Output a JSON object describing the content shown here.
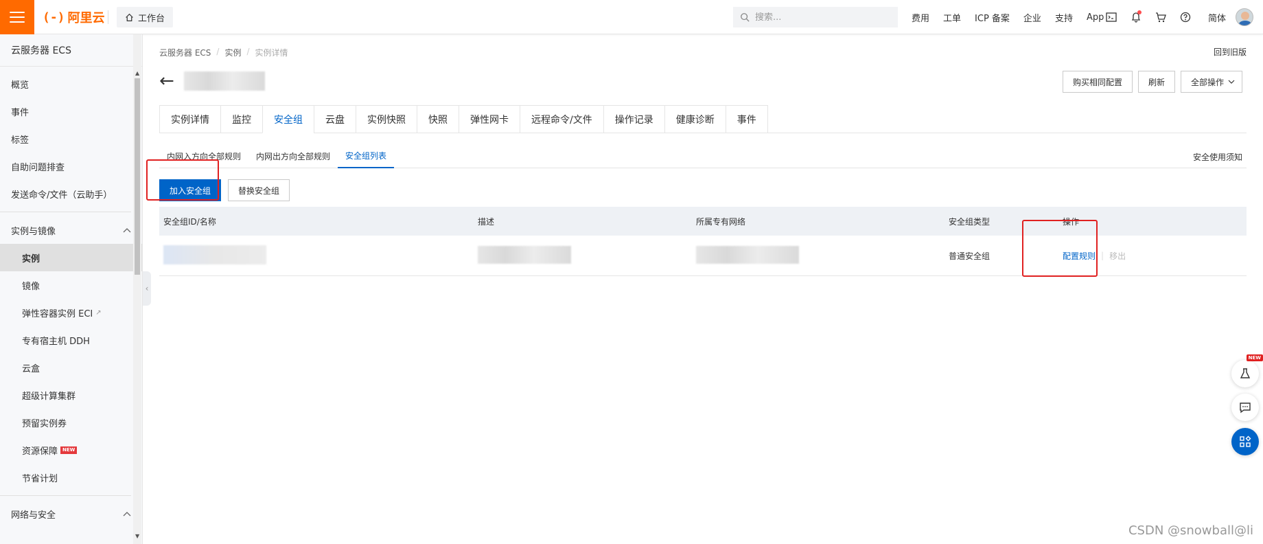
{
  "topbar": {
    "logo_text": "阿里云",
    "workbench_label": "工作台",
    "search_placeholder": "搜索...",
    "links": [
      "费用",
      "工单",
      "ICP 备案",
      "企业",
      "支持",
      "App"
    ],
    "lang_label": "简体"
  },
  "sidebar": {
    "title": "云服务器 ECS",
    "top_items": [
      "概览",
      "事件",
      "标签",
      "自助问题排查",
      "发送命令/文件（云助手）"
    ],
    "group1_label": "实例与镜像",
    "group1_items": [
      "实例",
      "镜像",
      "弹性容器实例 ECI",
      "专有宿主机 DDH",
      "云盒",
      "超级计算集群",
      "预留实例券",
      "资源保障",
      "节省计划"
    ],
    "group2_label": "网络与安全",
    "new_badge": "NEW"
  },
  "main": {
    "breadcrumb": [
      "云服务器 ECS",
      "实例",
      "实例详情"
    ],
    "back_old": "回到旧版",
    "actions": {
      "buy_same": "购买相同配置",
      "refresh": "刷新",
      "all_ops": "全部操作"
    },
    "tabs": [
      "实例详情",
      "监控",
      "安全组",
      "云盘",
      "实例快照",
      "快照",
      "弹性网卡",
      "远程命令/文件",
      "操作记录",
      "健康诊断",
      "事件"
    ],
    "active_tab": "安全组",
    "subtabs": [
      "内网入方向全部规则",
      "内网出方向全部规则",
      "安全组列表"
    ],
    "notice": "安全使用须知",
    "join_button": "加入安全组",
    "replace_button": "替换安全组",
    "table": {
      "headers": [
        "安全组ID/名称",
        "描述",
        "所属专有网络",
        "安全组类型",
        "操作"
      ],
      "rows": [
        {
          "type": "普通安全组",
          "action_config": "配置规则",
          "action_remove": "移出"
        }
      ]
    }
  },
  "floating": {
    "new_tag": "NEW"
  },
  "watermark": "CSDN @snowball@li",
  "colors": {
    "brand": "#ff6a00",
    "primary": "#0064c8",
    "highlight": "#e02020"
  }
}
